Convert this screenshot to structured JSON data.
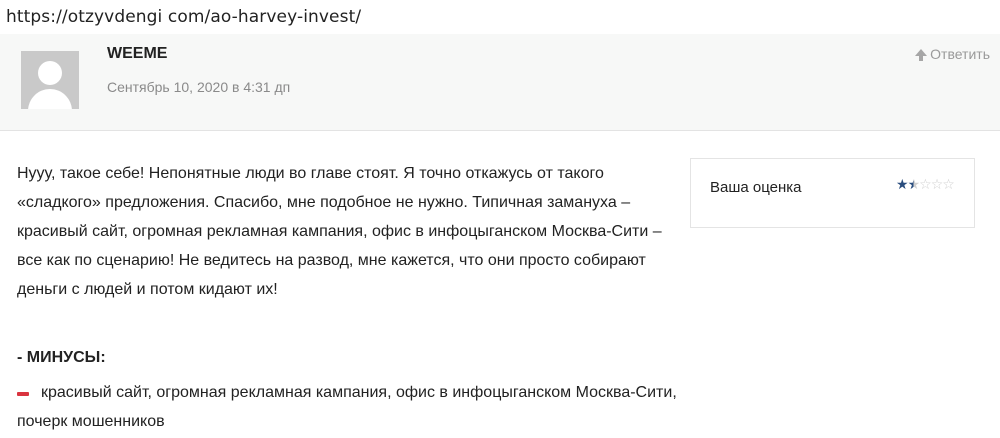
{
  "browser": {
    "url": "https://otzyvdengi com/ao-harvey-invest/"
  },
  "comment": {
    "author": "WEEME",
    "date": "Сентябрь 10, 2020 в 4:31 дп",
    "reply_label": "Ответить",
    "body": "Нууу, такое себе! Непонятные люди во главе стоят. Я точно откажусь от такого «сладкого» предложения. Спасибо, мне подобное не нужно. Типичная замануха – красивый сайт, огромная рекламная кампания, офис в инфоцыганском Москва-Сити – все как по сценарию! Не ведитесь на развод, мне кажется, что они просто собирают деньги с людей и потом кидают их!",
    "cons_title": "- МИНУСЫ:",
    "cons_text": "красивый сайт, огромная рекламная кампания, офис в инфоцыганском Москва-Сити, почерк мошенников"
  },
  "rating": {
    "label": "Ваша оценка",
    "value": 1.5,
    "max": 5,
    "star_color": "#2a4d7e",
    "empty_color": "#d0d0d0"
  },
  "colors": {
    "minus_accent": "#d9343f",
    "header_bg": "#f7f8f7"
  }
}
